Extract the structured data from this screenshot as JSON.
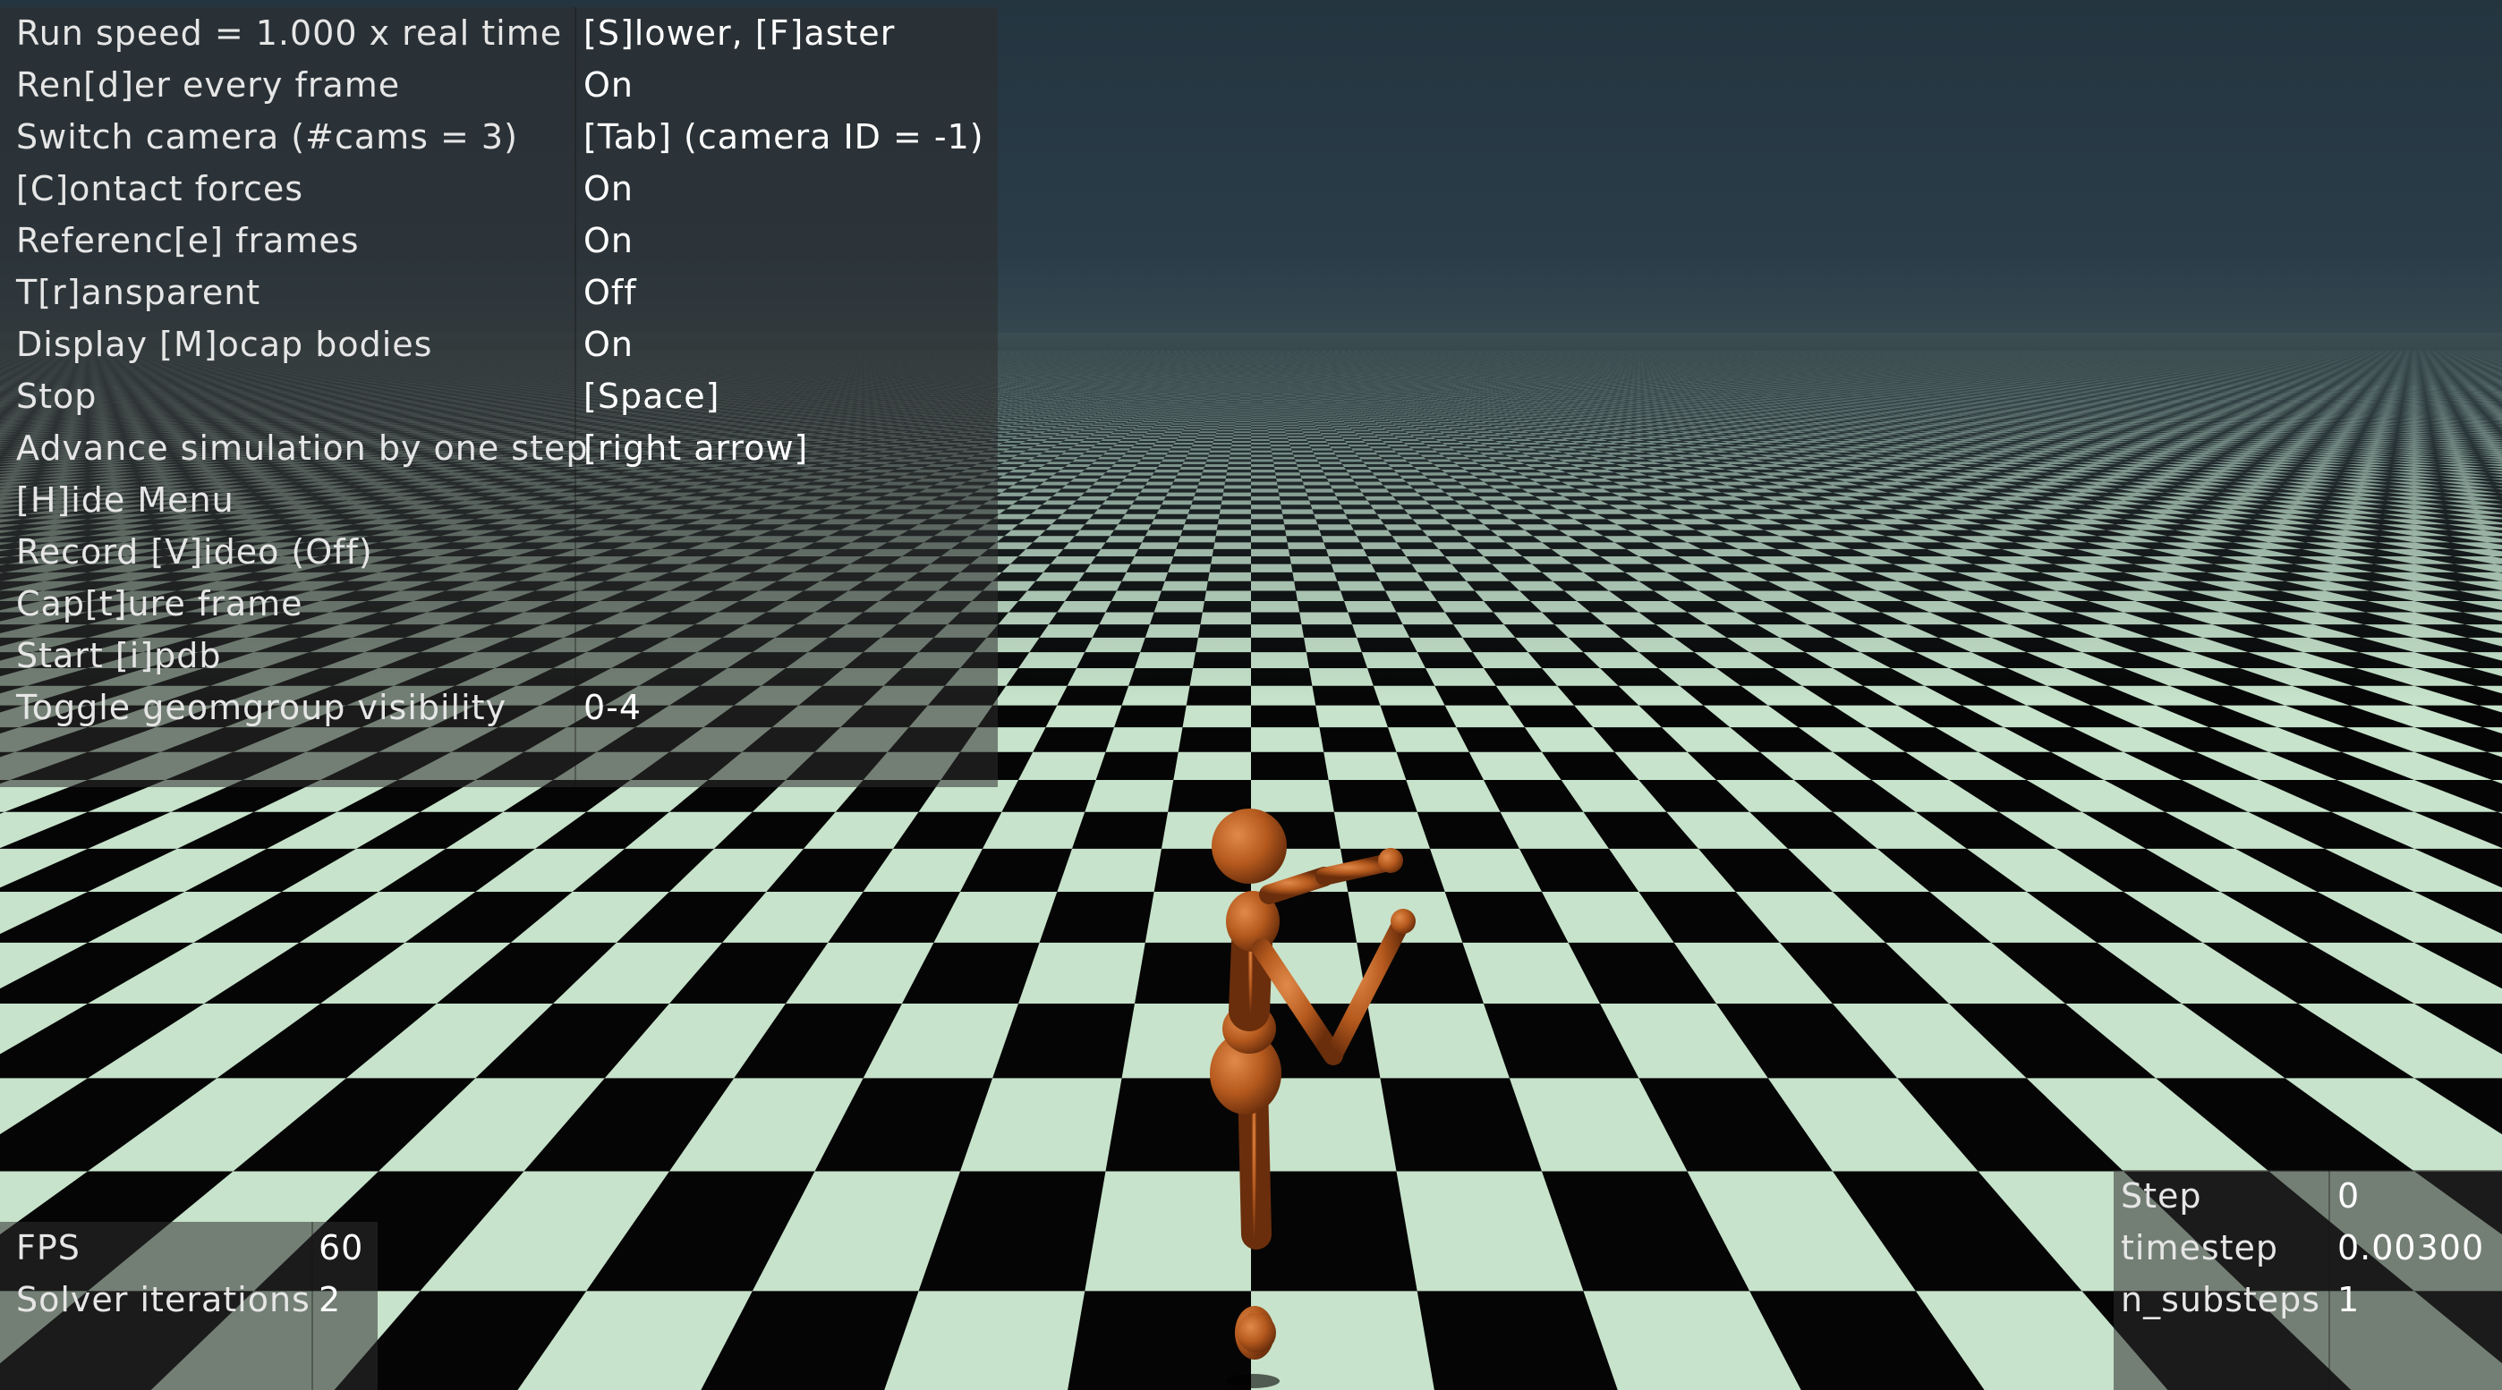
{
  "menu": {
    "items": [
      {
        "label": "Run speed = 1.000 x real time",
        "value": "[S]lower, [F]aster"
      },
      {
        "label": "Ren[d]er every frame",
        "value": "On"
      },
      {
        "label": "Switch camera (#cams = 3)",
        "value": "[Tab] (camera ID = -1)"
      },
      {
        "label": "[C]ontact forces",
        "value": "On"
      },
      {
        "label": "Referenc[e] frames",
        "value": "On"
      },
      {
        "label": "T[r]ansparent",
        "value": "Off"
      },
      {
        "label": "Display [M]ocap bodies",
        "value": "On"
      },
      {
        "label": "Stop",
        "value": "[Space]"
      },
      {
        "label": "Advance simulation by one step",
        "value": "[right arrow]"
      },
      {
        "label": "[H]ide Menu",
        "value": ""
      },
      {
        "label": "Record [V]ideo (Off)",
        "value": ""
      },
      {
        "label": "Cap[t]ure frame",
        "value": ""
      },
      {
        "label": "Start [i]pdb",
        "value": ""
      },
      {
        "label": "Toggle geomgroup visibility",
        "value": "0-4"
      }
    ]
  },
  "stats_left": {
    "fps_label": "FPS",
    "fps_value": "60",
    "solver_label": "Solver iterations",
    "solver_value": "2"
  },
  "stats_right": {
    "step_label": "Step",
    "step_value": "0",
    "timestep_label": "timestep",
    "timestep_value": "0.00300",
    "substeps_label": "n_substeps",
    "substeps_value": "1"
  },
  "colors": {
    "floor_light": "#c7e3cb",
    "floor_dark": "#050505",
    "body": "#b65a1e"
  }
}
